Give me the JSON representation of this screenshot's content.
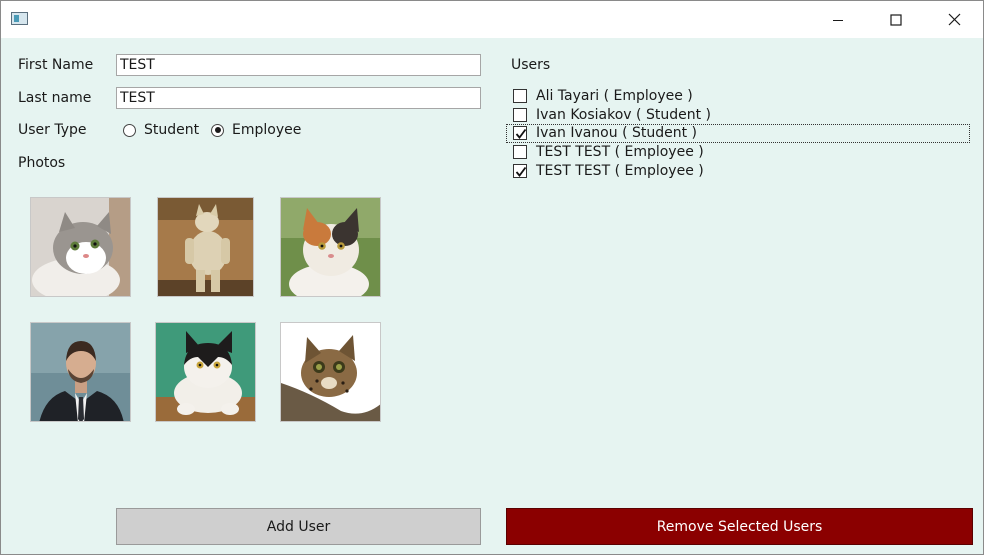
{
  "form": {
    "first_name_label": "First Name",
    "first_name_value": "TEST",
    "last_name_label": "Last name",
    "last_name_value": "TEST",
    "user_type_label": "User Type",
    "user_type_options": [
      "Student",
      "Employee"
    ],
    "user_type_selected": "Employee",
    "photos_label": "Photos"
  },
  "photos": [
    {
      "name": "white-grey-kitten",
      "selected": false
    },
    {
      "name": "standing-cat",
      "selected": false
    },
    {
      "name": "calico-cat",
      "selected": false
    },
    {
      "name": "man-in-suit",
      "selected": false
    },
    {
      "name": "black-white-cat",
      "selected": false
    },
    {
      "name": "wild-cat",
      "selected": false
    }
  ],
  "users": {
    "label": "Users",
    "items": [
      {
        "label": "Ali Tayari ( Employee )",
        "checked": false
      },
      {
        "label": "Ivan Kosiakov ( Student )",
        "checked": false
      },
      {
        "label": "Ivan Ivanou ( Student )",
        "checked": true,
        "focused": true
      },
      {
        "label": "TEST TEST ( Employee )",
        "checked": false
      },
      {
        "label": "TEST TEST ( Employee )",
        "checked": true
      }
    ]
  },
  "actions": {
    "add_user": "Add User",
    "remove_selected": "Remove Selected Users"
  },
  "colors": {
    "background": "#e6f4f1",
    "remove_button": "#8b0000",
    "add_button": "#cfcfcf"
  }
}
